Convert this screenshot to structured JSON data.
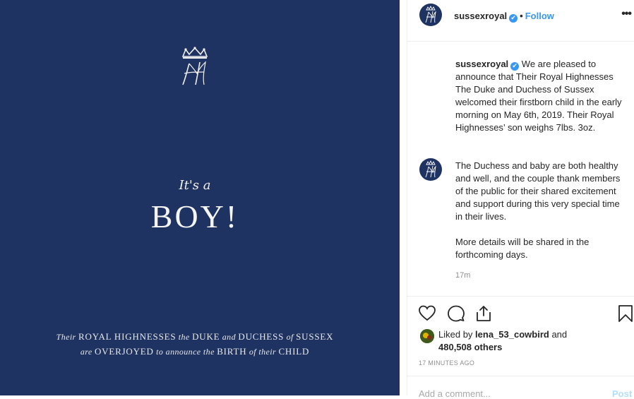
{
  "image": {
    "its_a": "It's a",
    "boy": "BOY!",
    "caption_line1": [
      "Their ",
      "ROYAL HIGHNESSES",
      " the ",
      "DUKE",
      " and ",
      "DUCHESS",
      " of ",
      "SUSSEX"
    ],
    "caption_line2": [
      "are ",
      "OVERJOYED",
      " to announce the ",
      "BIRTH",
      " of their ",
      "CHILD"
    ]
  },
  "header": {
    "username": "sussexroyal",
    "verified_icon": "✔",
    "dot": "•",
    "follow_label": "Follow",
    "more_icon": "•••"
  },
  "comments": {
    "caption_user": "sussexroyal",
    "caption_text": " We are pleased to announce that Their Royal Highnesses The Duke and Duchess of Sussex welcomed their firstborn child in the early morning on May 6th, 2019. Their Royal Highnesses’ son weighs 7lbs. 3oz.",
    "para2": "The Duchess and baby are both healthy and well, and the couple thank members of the public for their shared excitement and support during this very special time in their lives.",
    "para3": "More details will be shared in the forthcoming days.",
    "time": "17m"
  },
  "likes": {
    "prefix": "Liked by ",
    "user": "lena_53_cowbird",
    "mid": " and",
    "count": "480,508 others"
  },
  "posted_ago": "17 MINUTES AGO",
  "add_comment": {
    "placeholder": "Add a comment...",
    "post_label": "Post"
  },
  "colors": {
    "image_bg": "#1f3362",
    "accent_blue": "#3897f0"
  }
}
